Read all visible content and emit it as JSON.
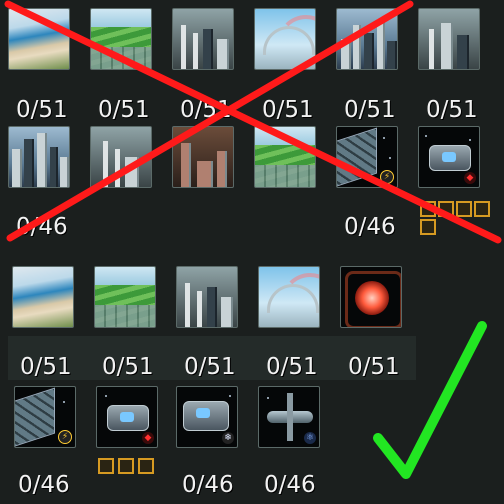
{
  "tiles": [
    {
      "art": "beach-resort-icon",
      "count": "0/51"
    },
    {
      "art": "farm-fields-icon",
      "count": "0/51"
    },
    {
      "art": "refinery-icon",
      "count": "0/51"
    },
    {
      "art": "rainbow-bridge-icon",
      "count": "0/51"
    },
    {
      "art": "city-skyline-icon",
      "count": "0/51"
    },
    {
      "art": "refinery-icon",
      "count": "0/51"
    },
    {
      "art": "city-skyline-icon",
      "count": "0/46"
    },
    {
      "art": "refinery-icon",
      "count": ""
    },
    {
      "art": "mine-icon",
      "count": ""
    },
    {
      "art": "farm-fields-icon",
      "count": ""
    },
    {
      "art": "solar-panel-icon",
      "count": "0/46"
    },
    {
      "art": "spaceship-icon",
      "count": ""
    },
    {
      "art": "beach-resort-icon",
      "count": "0/51"
    },
    {
      "art": "farm-fields-icon",
      "count": "0/51"
    },
    {
      "art": "refinery-icon",
      "count": "0/51"
    },
    {
      "art": "rainbow-bridge-icon",
      "count": "0/51"
    },
    {
      "art": "reactor-core-icon",
      "count": "0/51"
    },
    {
      "art": "solar-panel-icon",
      "count": "0/46"
    },
    {
      "art": "spaceship-icon",
      "count": ""
    },
    {
      "art": "starship-icon",
      "count": "0/46"
    },
    {
      "art": "space-station-icon",
      "count": "0/46"
    }
  ],
  "top_group": {
    "status": "rejected",
    "mark": "red-x-icon",
    "color": "#ff1a1a"
  },
  "bottom_group": {
    "status": "approved",
    "mark": "green-checkmark-icon",
    "color": "#22e622"
  },
  "slot_color": "#d69a22"
}
